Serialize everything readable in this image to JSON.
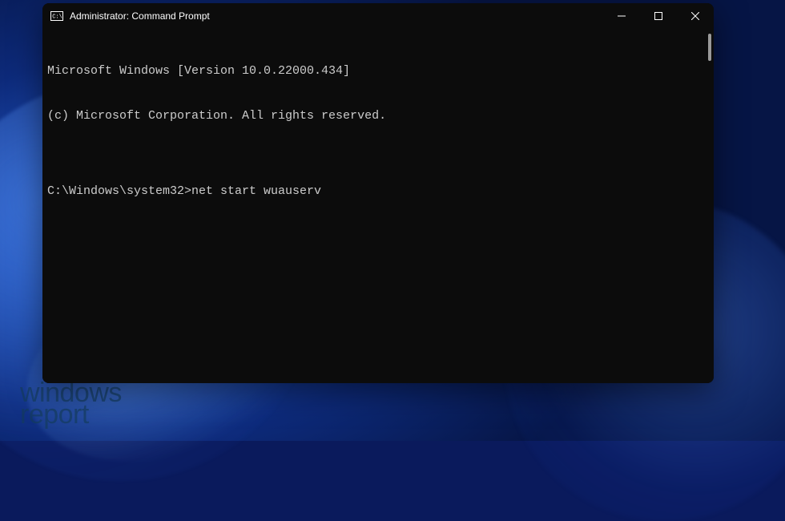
{
  "window": {
    "title": "Administrator: Command Prompt"
  },
  "terminal": {
    "line1": "Microsoft Windows [Version 10.0.22000.434]",
    "line2": "(c) Microsoft Corporation. All rights reserved.",
    "blank": "",
    "prompt": "C:\\Windows\\system32>",
    "command": "net start wuauserv"
  },
  "watermark": {
    "line1": "windows",
    "line2": "report"
  }
}
